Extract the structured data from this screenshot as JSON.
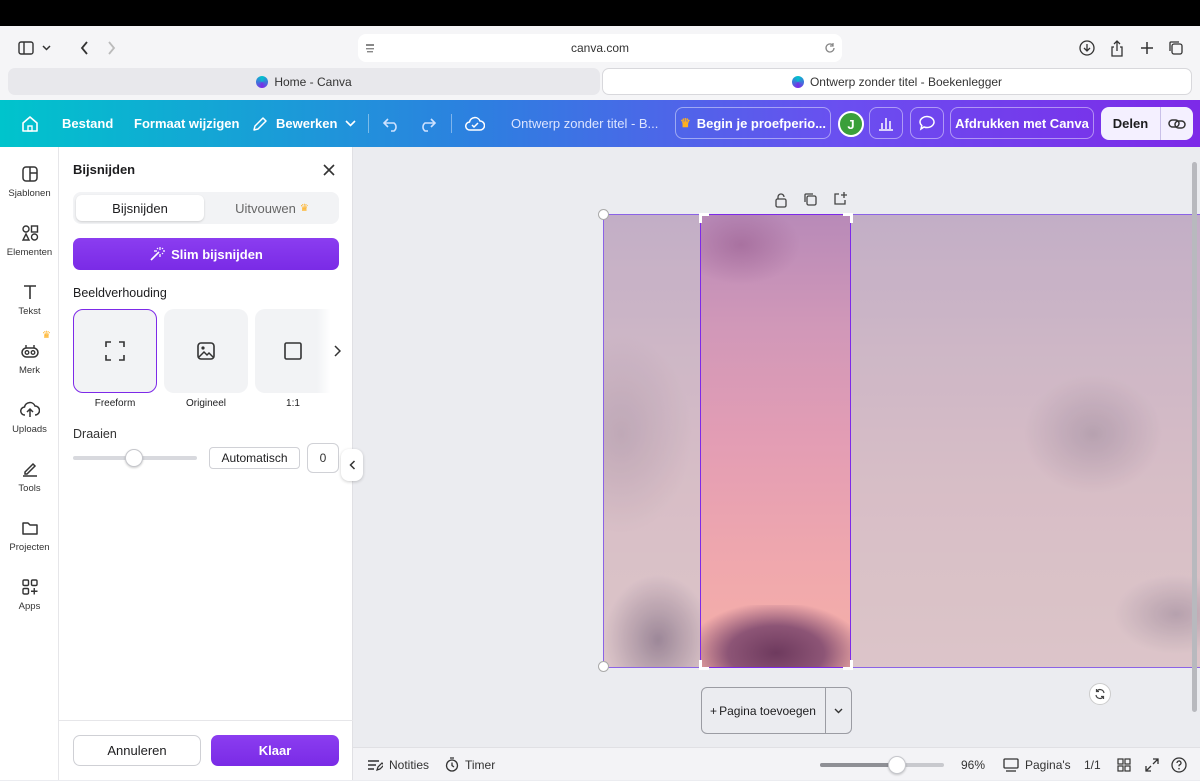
{
  "browser": {
    "url": "canva.com",
    "tabs": [
      {
        "label": "Home - Canva",
        "active": false
      },
      {
        "label": "Ontwerp zonder titel - Boekenlegger",
        "active": true
      }
    ]
  },
  "topbar": {
    "menu": [
      "Bestand",
      "Formaat wijzigen",
      "Bewerken"
    ],
    "doc_title": "Ontwerp zonder titel - B...",
    "trial_label": "Begin je proefperio...",
    "avatar_initial": "J",
    "print_label": "Afdrukken met Canva",
    "share_label": "Delen",
    "gradient_start": "#00c4cc",
    "gradient_end": "#7d2ae8"
  },
  "rail": {
    "items": [
      {
        "label": "Sjablonen",
        "icon": "layout-icon"
      },
      {
        "label": "Elementen",
        "icon": "shapes-icon"
      },
      {
        "label": "Tekst",
        "icon": "text-icon"
      },
      {
        "label": "Merk",
        "icon": "brand-icon"
      },
      {
        "label": "Uploads",
        "icon": "upload-icon"
      },
      {
        "label": "Tools",
        "icon": "pen-icon"
      },
      {
        "label": "Projecten",
        "icon": "folder-icon"
      },
      {
        "label": "Apps",
        "icon": "apps-icon"
      }
    ]
  },
  "panel": {
    "title": "Bijsnijden",
    "tabs": [
      "Bijsnijden",
      "Uitvouwen"
    ],
    "smart_crop_label": "Slim bijsnijden",
    "aspect_heading": "Beeldverhouding",
    "ratios": [
      "Freeform",
      "Origineel",
      "1:1"
    ],
    "rotate_heading": "Draaien",
    "rotate_auto_label": "Automatisch",
    "rotate_value": "0",
    "cancel_label": "Annuleren",
    "done_label": "Klaar",
    "accent": "#7d2ae8"
  },
  "canvas": {
    "add_page_label": "Pagina toevoegen"
  },
  "bottombar": {
    "notes_label": "Notities",
    "timer_label": "Timer",
    "zoom": "96%",
    "zoom_fraction": 0.62,
    "pages_label": "Pagina's",
    "page_count": "1/1"
  }
}
